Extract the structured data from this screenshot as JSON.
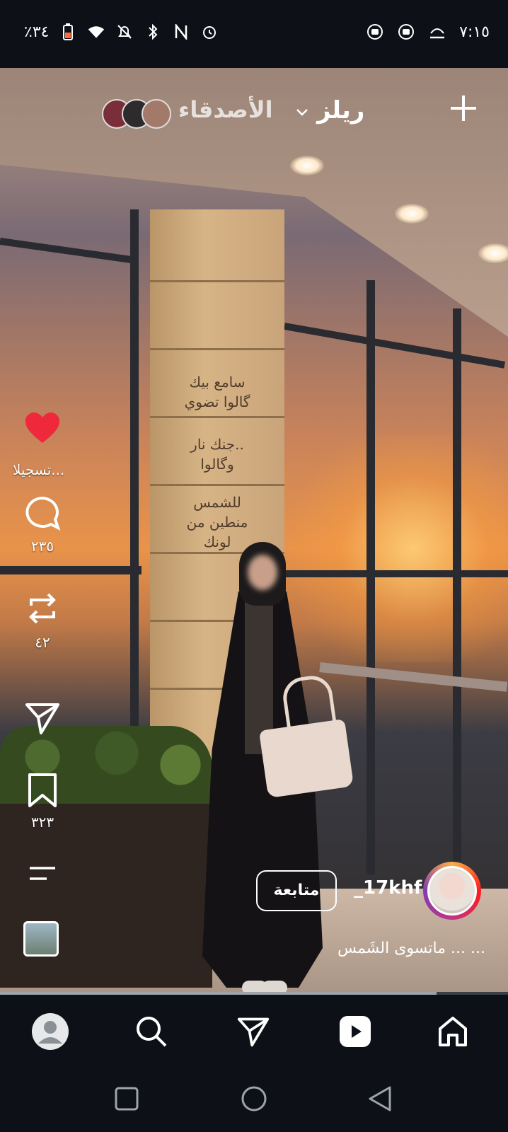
{
  "status_bar": {
    "battery_text": "٪٣٤",
    "time": "٧:١٥",
    "icons": [
      "battery-icon",
      "wifi-icon",
      "data-arrows-icon",
      "notifications-off-icon",
      "bluetooth-icon",
      "nfc-icon",
      "alarm-icon",
      "app-notification-icon",
      "app-notification-icon",
      "cast-icon"
    ]
  },
  "header": {
    "title": "ريلز",
    "friends_label": "الأصدقاء",
    "create_icon": "plus-icon",
    "dropdown_icon": "chevron-down-icon"
  },
  "reel": {
    "poster_text_lines": [
      "سامع بيك",
      "گالوا تضوي",
      "جنك نار..",
      "وگالوا",
      "للشمس",
      "منطين من",
      "لونك"
    ]
  },
  "actions": {
    "likes_label": "تسجيلا...",
    "comments_count": "٢٣٥",
    "reposts_count": "٤٢",
    "saves_count": "٣٢٣",
    "like_color": "#f0283c"
  },
  "author": {
    "username": "_17khf",
    "follow_label": "متابعة",
    "caption": "ماتسوى الشَمس ... ..."
  },
  "progress": {
    "fraction": 0.86
  },
  "bottom_nav": {
    "items": [
      "profile-tab",
      "search-tab",
      "messages-tab",
      "reels-tab",
      "home-tab"
    ],
    "active": "reels-tab"
  },
  "system_nav": [
    "recents-button",
    "home-button",
    "back-button"
  ]
}
